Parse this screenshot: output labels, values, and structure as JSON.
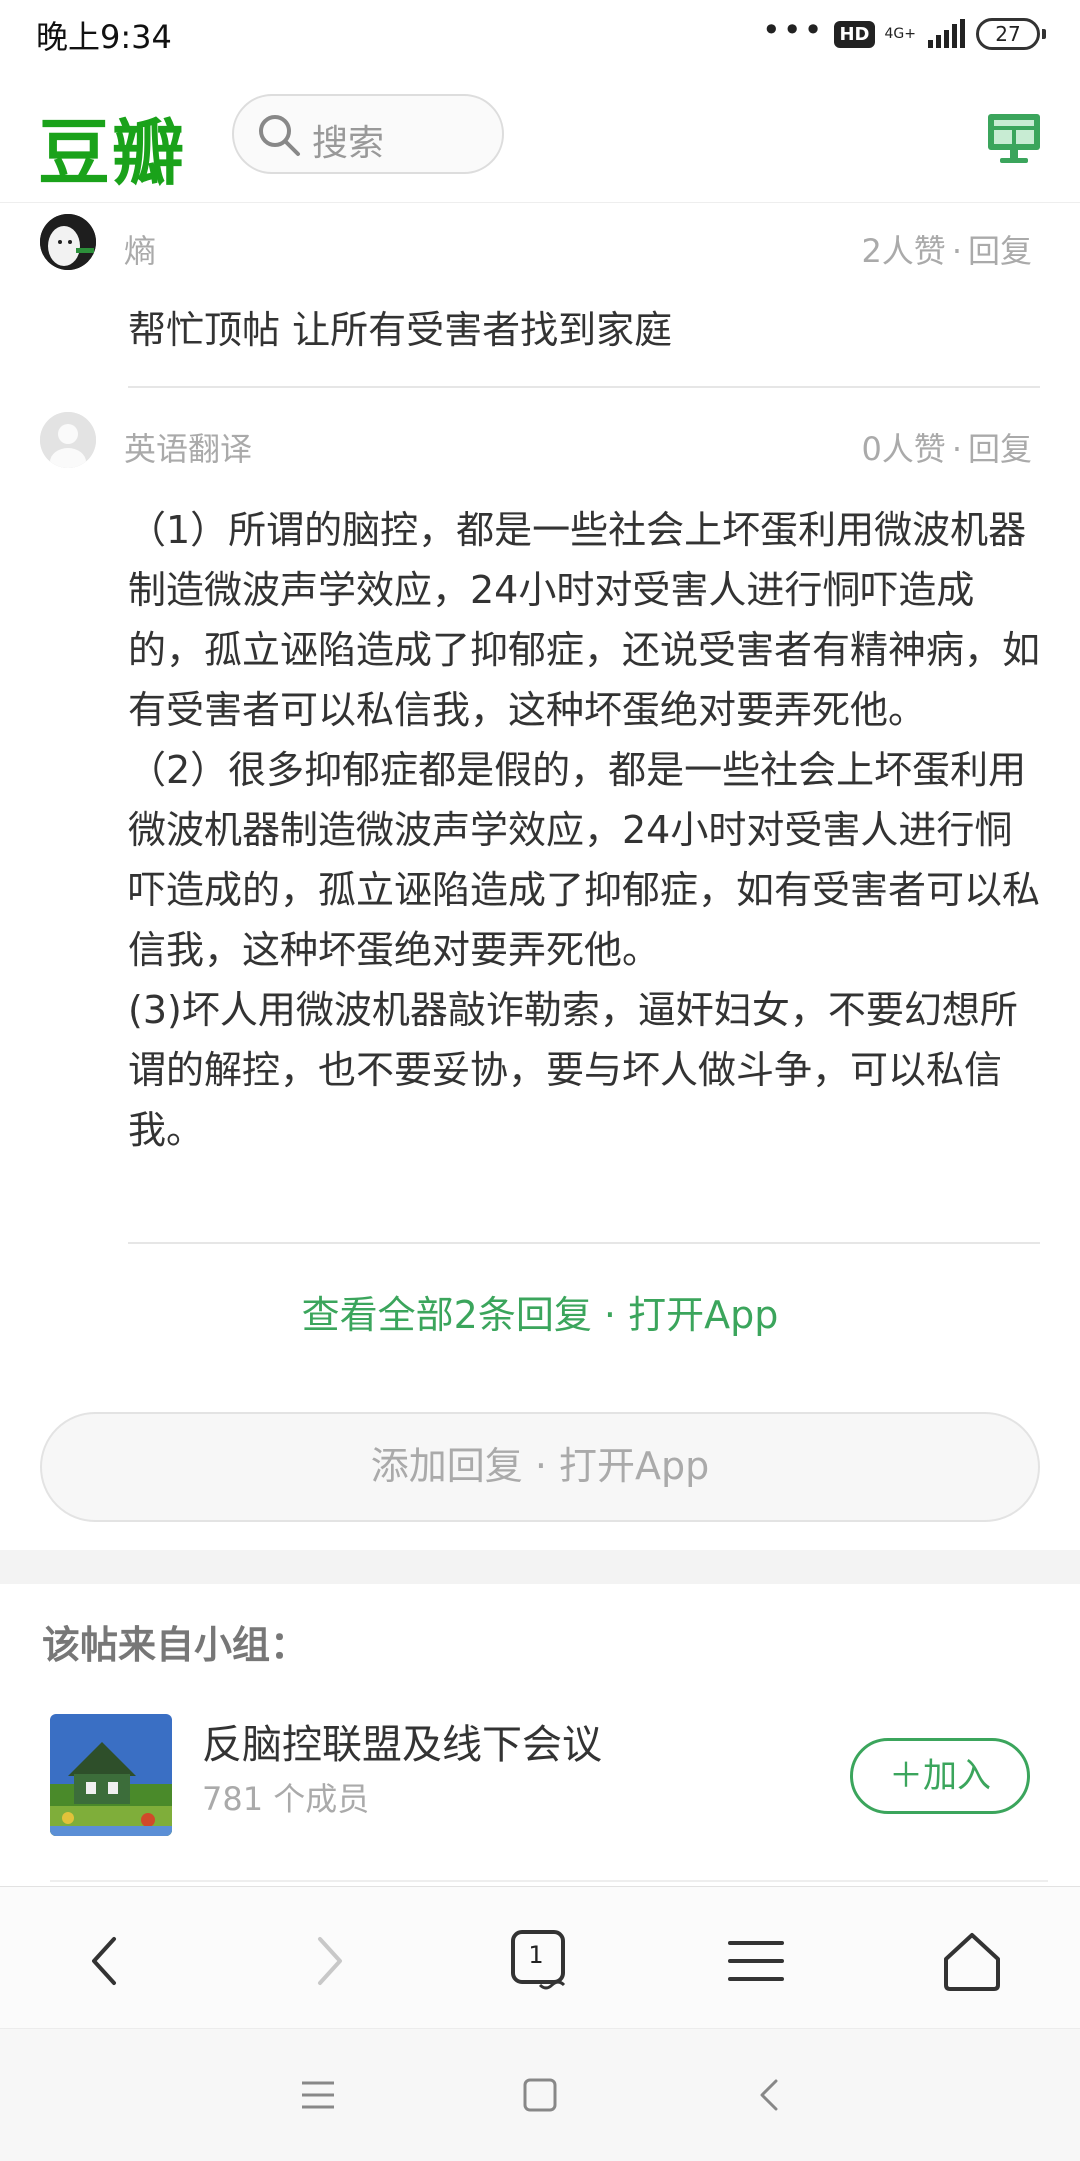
{
  "status_bar": {
    "time": "晚上9:34",
    "dots": "•••",
    "hd": "HD",
    "network": "4G+",
    "battery": "27"
  },
  "header": {
    "logo": "豆瓣",
    "search_placeholder": "搜索",
    "brand_color": "#1aa21a"
  },
  "comments": [
    {
      "username": "熵",
      "likes": "2人赞",
      "reply": "回复",
      "text": "帮忙顶帖 让所有受害者找到家庭"
    },
    {
      "username": "英语翻译",
      "likes": "0人赞",
      "reply": "回复",
      "paragraphs": [
        "（1）所谓的脑控，都是一些社会上坏蛋利用微波机器制造微波声学效应，24小时对受害人进行恫吓造成的，孤立诬陷造成了抑郁症，还说受害者有精神病，如有受害者可以私信我，这种坏蛋绝对要弄死他。",
        "（2）很多抑郁症都是假的，都是一些社会上坏蛋利用微波机器制造微波声学效应，24小时对受害人进行恫吓造成的，孤立诬陷造成了抑郁症，如有受害者可以私信我，这种坏蛋绝对要弄死他。",
        "(3)坏人用微波机器敲诈勒索，逼奸妇女，不要幻想所谓的解控，也不要妥协，要与坏人做斗争，可以私信我。"
      ]
    }
  ],
  "view_all": "查看全部2条回复 · 打开App",
  "add_reply": "添加回复 · 打开App",
  "group": {
    "heading": "该帖来自小组：",
    "name": "反脑控联盟及线下会议",
    "members": "781 个成员",
    "join_label": "＋加入"
  },
  "browser_bar": {
    "tab_count": "1",
    "icons": [
      "back-arrow-icon",
      "forward-arrow-icon",
      "tabs-icon",
      "menu-icon",
      "home-icon"
    ]
  },
  "system_nav": {
    "icons": [
      "recents-icon",
      "home-square-icon",
      "back-icon"
    ]
  },
  "accent_color": "#3ba55c"
}
